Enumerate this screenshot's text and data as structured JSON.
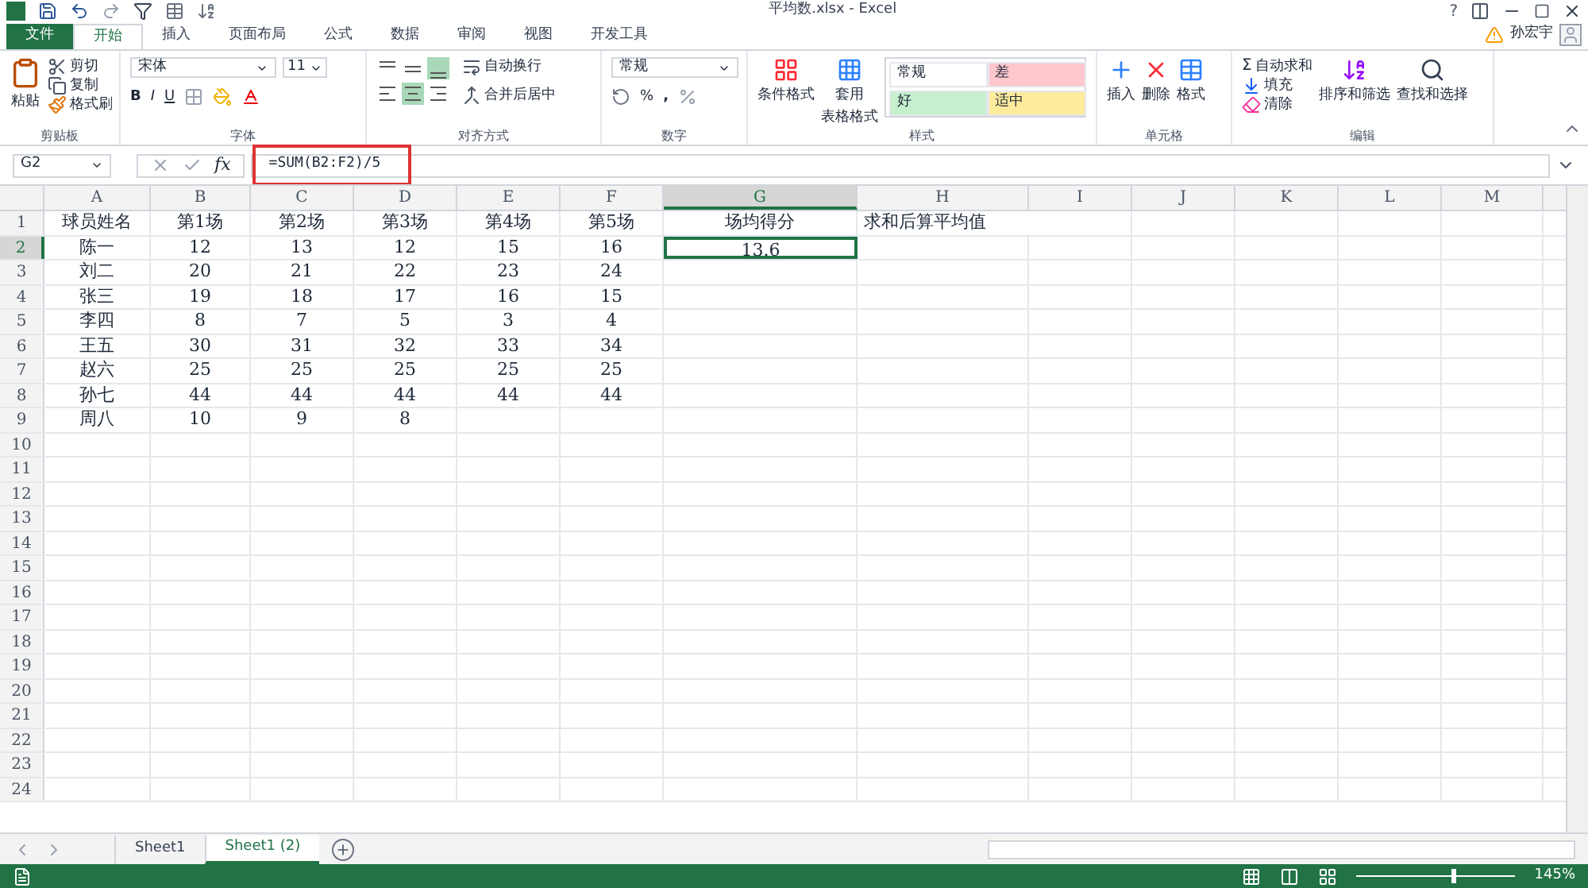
{
  "window": {
    "title": "平均数.xlsx - Excel",
    "help": "?",
    "user": "孙宏宇"
  },
  "tabs": [
    {
      "label": "文件",
      "kind": "file",
      "selected": false
    },
    {
      "label": "开始",
      "kind": "tab",
      "selected": true
    },
    {
      "label": "插入",
      "kind": "tab",
      "selected": false
    },
    {
      "label": "页面布局",
      "kind": "tab",
      "selected": false
    },
    {
      "label": "公式",
      "kind": "tab",
      "selected": false
    },
    {
      "label": "数据",
      "kind": "tab",
      "selected": false
    },
    {
      "label": "审阅",
      "kind": "tab",
      "selected": false
    },
    {
      "label": "视图",
      "kind": "tab",
      "selected": false
    },
    {
      "label": "开发工具",
      "kind": "tab",
      "selected": false
    }
  ],
  "ribbon": {
    "clipboard": {
      "label": "剪贴板",
      "paste": "粘贴",
      "cut": "剪切",
      "copy": "复制",
      "painter": "格式刷"
    },
    "font": {
      "label": "字体",
      "name": "宋体",
      "size": "11",
      "bold": "B",
      "italic": "I",
      "underline": "U"
    },
    "alignment": {
      "label": "对齐方式",
      "wrap": "自动换行",
      "merge": "合并后居中",
      "buttons": [
        {
          "kind": "top",
          "selected": false
        },
        {
          "kind": "middle",
          "selected": false
        },
        {
          "kind": "bottom",
          "selected": true
        },
        {
          "kind": "left",
          "selected": false
        },
        {
          "kind": "center",
          "selected": true
        },
        {
          "kind": "right",
          "selected": false
        }
      ]
    },
    "number": {
      "label": "数字",
      "format": "常规",
      "percent": "%",
      "comma": ","
    },
    "styles": {
      "label": "样式",
      "conditional": "条件格式",
      "table": "套用",
      "table2": "表格格式",
      "cells": [
        {
          "label": "常规",
          "color": "#ffffff"
        },
        {
          "label": "差",
          "color": "#ffc7ce"
        },
        {
          "label": "好",
          "color": "#c6efce"
        },
        {
          "label": "适中",
          "color": "#ffeb9c"
        }
      ]
    },
    "cells": {
      "label": "单元格",
      "insert": "插入",
      "delete": "删除",
      "format": "格式"
    },
    "editing": {
      "label": "编辑",
      "sigma": "Σ",
      "autosum": "自动求和",
      "fill": "填充",
      "clear": "清除",
      "sort": "排序和筛选",
      "find": "查找和选择"
    }
  },
  "formula_bar": {
    "name_box": "G2",
    "fx": "fx",
    "formula": "=SUM(B2:F2)/5",
    "highlighted": true
  },
  "columns": [
    {
      "label": "A",
      "selected": false
    },
    {
      "label": "B",
      "selected": false
    },
    {
      "label": "C",
      "selected": false
    },
    {
      "label": "D",
      "selected": false
    },
    {
      "label": "E",
      "selected": false
    },
    {
      "label": "F",
      "selected": false
    },
    {
      "label": "G",
      "selected": true
    },
    {
      "label": "H",
      "selected": false
    },
    {
      "label": "I",
      "selected": false
    },
    {
      "label": "J",
      "selected": false
    },
    {
      "label": "K",
      "selected": false
    },
    {
      "label": "L",
      "selected": false
    },
    {
      "label": "M",
      "selected": false
    }
  ],
  "rows": [
    {
      "label": "1",
      "selected": false,
      "cells": [
        {
          "text": "球员姓名",
          "selected": false
        },
        {
          "text": "第1场",
          "selected": false
        },
        {
          "text": "第2场",
          "selected": false
        },
        {
          "text": "第3场",
          "selected": false
        },
        {
          "text": "第4场",
          "selected": false
        },
        {
          "text": "第5场",
          "selected": false
        },
        {
          "text": "场均得分",
          "selected": false
        },
        {
          "text": "求和后算平均值",
          "selected": false
        }
      ]
    },
    {
      "label": "2",
      "selected": true,
      "cells": [
        {
          "text": "陈一",
          "selected": false
        },
        {
          "text": "12",
          "selected": false
        },
        {
          "text": "13",
          "selected": false
        },
        {
          "text": "12",
          "selected": false
        },
        {
          "text": "15",
          "selected": false
        },
        {
          "text": "16",
          "selected": false
        },
        {
          "text": "13.6",
          "selected": true
        }
      ]
    },
    {
      "label": "3",
      "selected": false,
      "cells": [
        {
          "text": "刘二",
          "selected": false
        },
        {
          "text": "20",
          "selected": false
        },
        {
          "text": "21",
          "selected": false
        },
        {
          "text": "22",
          "selected": false
        },
        {
          "text": "23",
          "selected": false
        },
        {
          "text": "24",
          "selected": false
        }
      ]
    },
    {
      "label": "4",
      "selected": false,
      "cells": [
        {
          "text": "张三",
          "selected": false
        },
        {
          "text": "19",
          "selected": false
        },
        {
          "text": "18",
          "selected": false
        },
        {
          "text": "17",
          "selected": false
        },
        {
          "text": "16",
          "selected": false
        },
        {
          "text": "15",
          "selected": false
        }
      ]
    },
    {
      "label": "5",
      "selected": false,
      "cells": [
        {
          "text": "李四",
          "selected": false
        },
        {
          "text": "8",
          "selected": false
        },
        {
          "text": "7",
          "selected": false
        },
        {
          "text": "5",
          "selected": false
        },
        {
          "text": "3",
          "selected": false
        },
        {
          "text": "4",
          "selected": false
        }
      ]
    },
    {
      "label": "6",
      "selected": false,
      "cells": [
        {
          "text": "王五",
          "selected": false
        },
        {
          "text": "30",
          "selected": false
        },
        {
          "text": "31",
          "selected": false
        },
        {
          "text": "32",
          "selected": false
        },
        {
          "text": "33",
          "selected": false
        },
        {
          "text": "34",
          "selected": false
        }
      ]
    },
    {
      "label": "7",
      "selected": false,
      "cells": [
        {
          "text": "赵六",
          "selected": false
        },
        {
          "text": "25",
          "selected": false
        },
        {
          "text": "25",
          "selected": false
        },
        {
          "text": "25",
          "selected": false
        },
        {
          "text": "25",
          "selected": false
        },
        {
          "text": "25",
          "selected": false
        }
      ]
    },
    {
      "label": "8",
      "selected": false,
      "cells": [
        {
          "text": "孙七",
          "selected": false
        },
        {
          "text": "44",
          "selected": false
        },
        {
          "text": "44",
          "selected": false
        },
        {
          "text": "44",
          "selected": false
        },
        {
          "text": "44",
          "selected": false
        },
        {
          "text": "44",
          "selected": false
        }
      ]
    },
    {
      "label": "9",
      "selected": false,
      "cells": [
        {
          "text": "周八",
          "selected": false
        },
        {
          "text": "10",
          "selected": false
        },
        {
          "text": "9",
          "selected": false
        },
        {
          "text": "8",
          "selected": false
        }
      ]
    },
    {
      "label": "10",
      "selected": false
    },
    {
      "label": "11",
      "selected": false
    },
    {
      "label": "12",
      "selected": false
    },
    {
      "label": "13",
      "selected": false
    },
    {
      "label": "14",
      "selected": false
    },
    {
      "label": "15",
      "selected": false
    },
    {
      "label": "16",
      "selected": false
    },
    {
      "label": "17",
      "selected": false
    },
    {
      "label": "18",
      "selected": false
    },
    {
      "label": "19",
      "selected": false
    },
    {
      "label": "20",
      "selected": false
    },
    {
      "label": "21",
      "selected": false
    },
    {
      "label": "22",
      "selected": false
    },
    {
      "label": "23",
      "selected": false
    },
    {
      "label": "24",
      "selected": false
    }
  ],
  "sheets": [
    {
      "label": "Sheet1",
      "selected": false
    },
    {
      "label": "Sheet1 (2)",
      "selected": true
    }
  ],
  "status_bar": {
    "zoom_slider": {
      "level": 0.6
    },
    "zoom": "145%"
  }
}
